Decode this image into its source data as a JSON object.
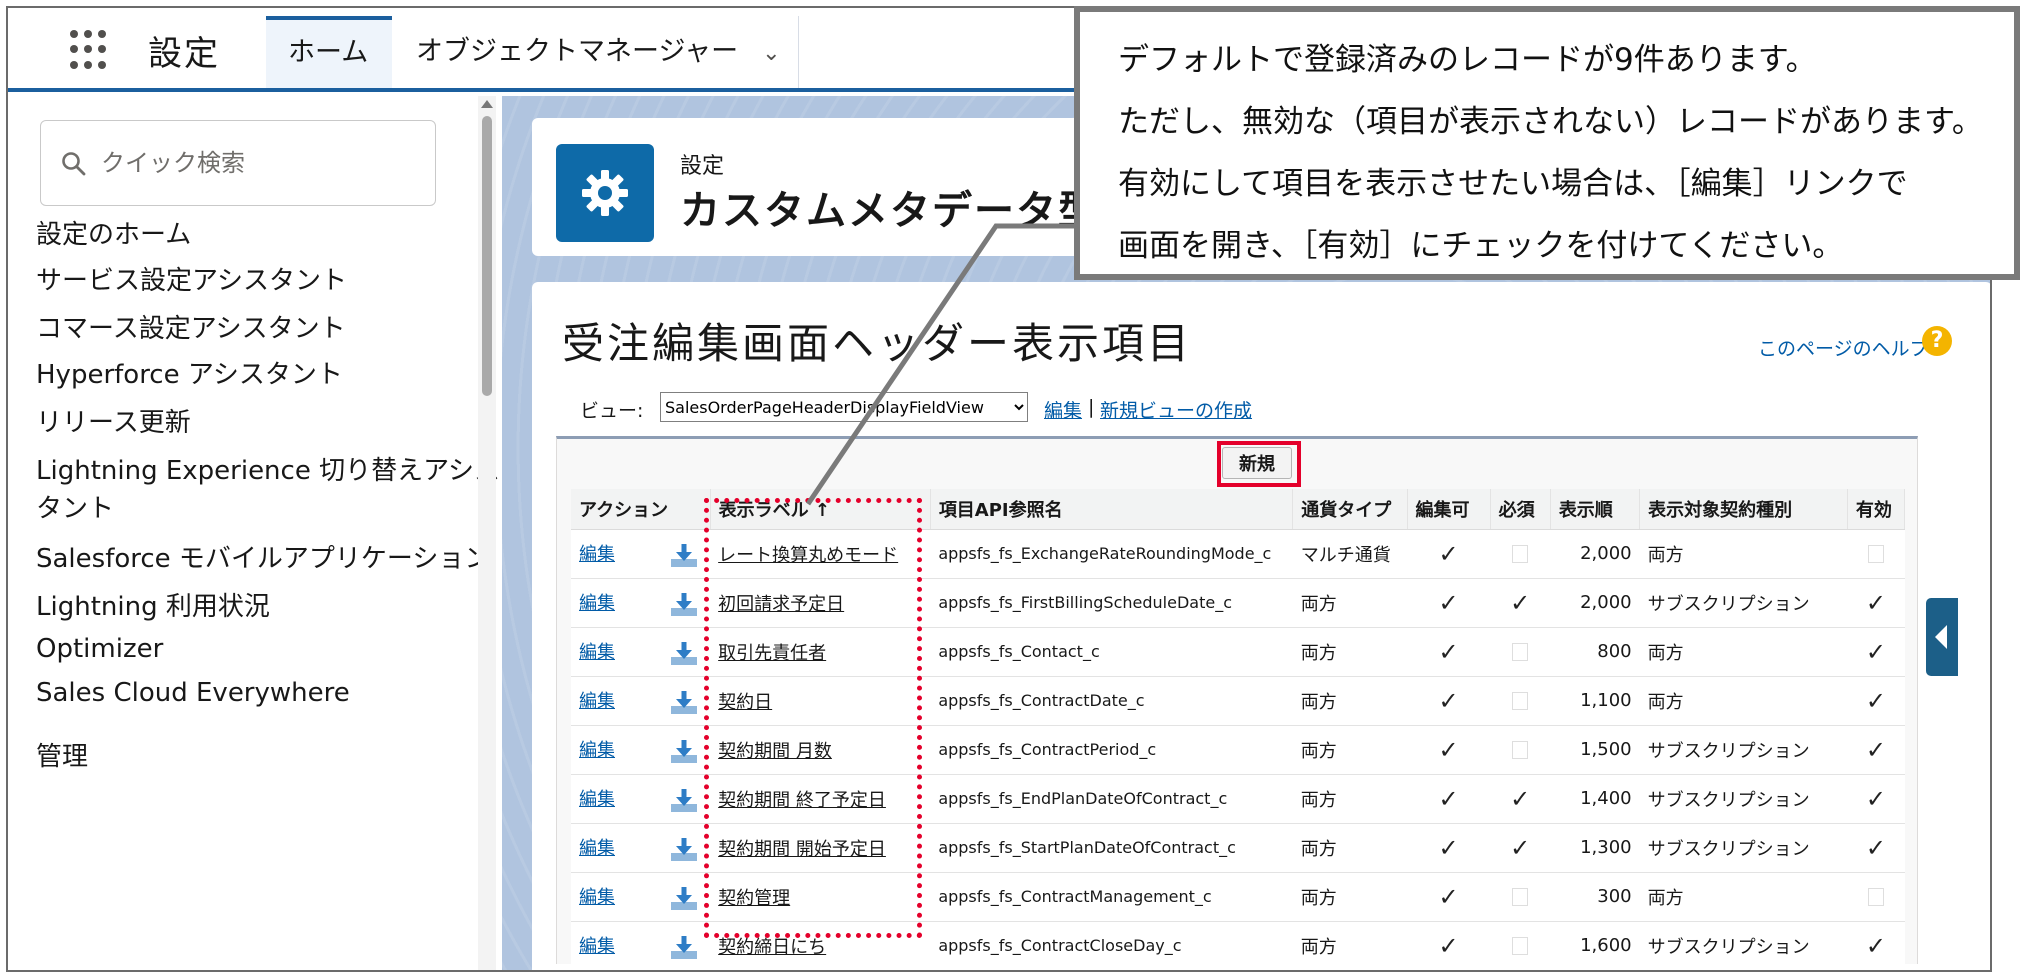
{
  "topbar": {
    "app_name": "設定",
    "tabs": [
      {
        "label": "ホーム"
      },
      {
        "label": "オブジェクトマネージャー"
      }
    ],
    "chevron": "⌄"
  },
  "sidebar": {
    "quick_find_placeholder": "クイック検索",
    "items": [
      {
        "label": "設定のホーム"
      },
      {
        "label": "サービス設定アシスタント"
      },
      {
        "label": "コマース設定アシスタント"
      },
      {
        "label": "Hyperforce アシスタント"
      },
      {
        "label": "リリース更新"
      },
      {
        "label": "Lightning Experience 切り替えアシス"
      },
      {
        "label": "タント"
      },
      {
        "label": "Salesforce モバイルアプリケーション"
      },
      {
        "label": "Lightning 利用状況"
      },
      {
        "label": "Optimizer"
      },
      {
        "label": "Sales Cloud Everywhere"
      },
      {
        "label": "管理"
      }
    ]
  },
  "header": {
    "eyebrow": "設定",
    "title": "カスタムメタデータ型"
  },
  "content": {
    "page_title": "受注編集画面ヘッダー表示項目",
    "help_link": "このページのヘルプ",
    "help_icon": "?",
    "view_label": "ビュー:",
    "view_selected": "SalesOrderPageHeaderDisplayFieldView",
    "view_edit": "編集",
    "view_separator": "|",
    "view_create": "新規ビューの作成",
    "new_button": "新規"
  },
  "table": {
    "columns": [
      "アクション",
      "表示ラベル ↑",
      "項目API参照名",
      "通貨タイプ",
      "編集可",
      "必須",
      "表示順",
      "表示対象契約種別",
      "有効"
    ],
    "rows": [
      {
        "action": "編集",
        "label": "レート換算丸めモード",
        "api": "appsfs_fs_ExchangeRateRoundingMode_c",
        "currency": "マルチ通貨",
        "editable": true,
        "required": false,
        "order": "2,000",
        "contract": "両方",
        "active": false
      },
      {
        "action": "編集",
        "label": "初回請求予定日",
        "api": "appsfs_fs_FirstBillingScheduleDate_c",
        "currency": "両方",
        "editable": true,
        "required": true,
        "order": "2,000",
        "contract": "サブスクリプション",
        "active": true
      },
      {
        "action": "編集",
        "label": "取引先責任者",
        "api": "appsfs_fs_Contact_c",
        "currency": "両方",
        "editable": true,
        "required": false,
        "order": "800",
        "contract": "両方",
        "active": true
      },
      {
        "action": "編集",
        "label": "契約日",
        "api": "appsfs_fs_ContractDate_c",
        "currency": "両方",
        "editable": true,
        "required": false,
        "order": "1,100",
        "contract": "両方",
        "active": true
      },
      {
        "action": "編集",
        "label": "契約期間 月数",
        "api": "appsfs_fs_ContractPeriod_c",
        "currency": "両方",
        "editable": true,
        "required": false,
        "order": "1,500",
        "contract": "サブスクリプション",
        "active": true
      },
      {
        "action": "編集",
        "label": "契約期間 終了予定日",
        "api": "appsfs_fs_EndPlanDateOfContract_c",
        "currency": "両方",
        "editable": true,
        "required": true,
        "order": "1,400",
        "contract": "サブスクリプション",
        "active": true
      },
      {
        "action": "編集",
        "label": "契約期間 開始予定日",
        "api": "appsfs_fs_StartPlanDateOfContract_c",
        "currency": "両方",
        "editable": true,
        "required": true,
        "order": "1,300",
        "contract": "サブスクリプション",
        "active": true
      },
      {
        "action": "編集",
        "label": "契約管理",
        "api": "appsfs_fs_ContractManagement_c",
        "currency": "両方",
        "editable": true,
        "required": false,
        "order": "300",
        "contract": "両方",
        "active": false
      },
      {
        "action": "編集",
        "label": "契約締日にち",
        "api": "appsfs_fs_ContractCloseDay_c",
        "currency": "両方",
        "editable": true,
        "required": false,
        "order": "1,600",
        "contract": "サブスクリプション",
        "active": true
      }
    ]
  },
  "callout": {
    "lines": [
      "デフォルトで登録済みのレコードが9件あります。",
      "ただし、無効な（項目が表示されない）レコードがあります。",
      "有効にして項目を表示させたい場合は、［編集］リンクで",
      "画面を開き、［有効］にチェックを付けてください。"
    ]
  },
  "colors": {
    "brand_blue": "#1b5f9e",
    "link_blue": "#015ba7",
    "highlight_red": "#e4002b",
    "callout_border": "#7a7a7a"
  },
  "icons": {
    "app_launcher": "waffle-icon",
    "search": "search-icon",
    "setup": "gear-icon",
    "download": "download-arrow-icon",
    "help": "help-icon",
    "panel_toggle": "caret-left-icon"
  }
}
